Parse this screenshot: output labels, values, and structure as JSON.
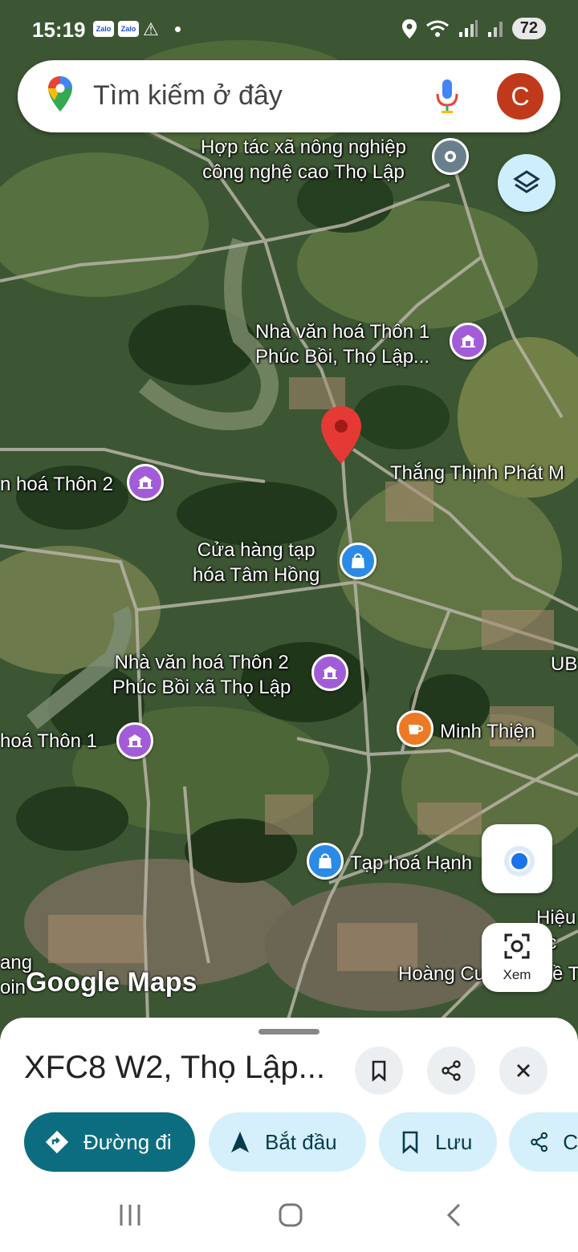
{
  "status_bar": {
    "time": "15:19",
    "notif_app_1": "Zalo",
    "notif_app_2": "Zalo",
    "battery": "72"
  },
  "search": {
    "placeholder": "Tìm kiếm ở đây",
    "avatar_letter": "C"
  },
  "map": {
    "labels": {
      "coop": "Hợp tác xã nông nghiệp\ncông nghệ cao Thọ Lập",
      "nvh_thon1_phucboi": "Nhà văn hoá Thôn 1\nPhúc Bồi, Thọ Lập...",
      "thang_thinh": "Thắng Thịnh Phát M",
      "nvh_thon2_left": "n hoá Thôn 2",
      "cua_hang": "Cửa hàng tạp\nhóa Tâm Hồng",
      "nvh_thon2_phucboi": "Nhà văn hoá Thôn 2\nPhúc Bồi xã Thọ Lập",
      "nvh_thon1_left": "hoá Thôn 1",
      "minh_thien": "Minh Thiện",
      "tap_hoa_hanh": "Tạp hoá Hạnh",
      "ub_edge": "UB",
      "hieu_edge": "Hiệu\nọc",
      "hoang_edge": "Hoàng Cu",
      "ang_edge": "ang\noin",
      "e_t_edge": "ề T"
    },
    "logo": "Google Maps"
  },
  "controls": {
    "lens_label": "Xem"
  },
  "sheet": {
    "title": "XFC8 W2, Thọ Lập...",
    "actions": {
      "directions": "Đường đi",
      "start": "Bắt đầu",
      "save": "Lưu",
      "share": "C"
    }
  },
  "colors": {
    "accent": "#0d6d80",
    "pill_bg": "#d5f0fb",
    "marker_red": "#e53935",
    "poi_purple": "#a35cd8",
    "poi_blue": "#2b8ae5",
    "poi_orange": "#ec7a25",
    "avatar_bg": "#c0391b"
  }
}
